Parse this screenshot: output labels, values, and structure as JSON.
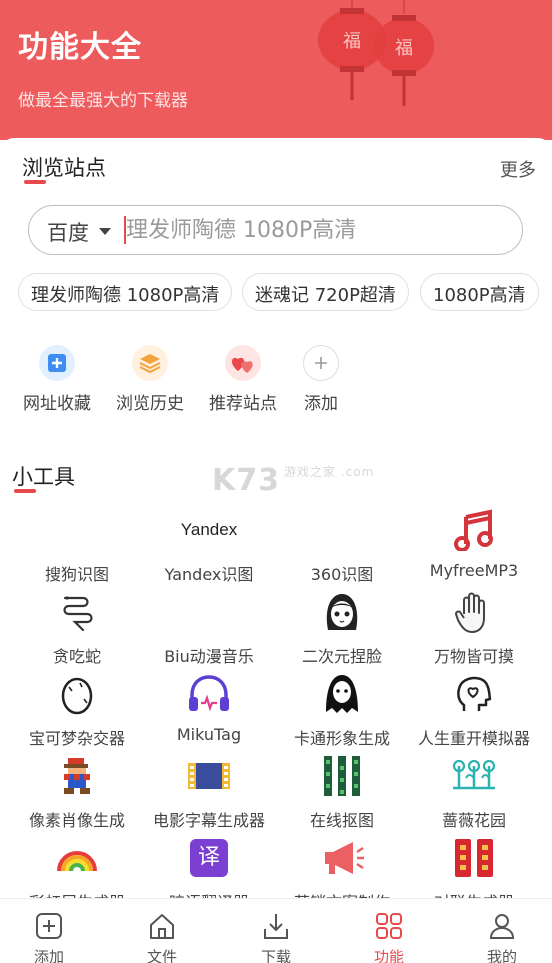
{
  "header": {
    "title": "功能大全",
    "subtitle": "做最全最强大的下载器",
    "lantern_char": "福",
    "bg_color": "#ee5b5d"
  },
  "browse": {
    "title": "浏览站点",
    "more_label": "更多",
    "search": {
      "engine": "百度",
      "placeholder": "理发师陶德 1080P高清"
    },
    "chips": [
      "理发师陶德 1080P高清",
      "迷魂记 720P超清",
      "1080P高清"
    ],
    "quick_actions": [
      {
        "label": "网址收藏",
        "icon": "bookmark-plus-icon"
      },
      {
        "label": "浏览历史",
        "icon": "history-layers-icon"
      },
      {
        "label": "推荐站点",
        "icon": "recommend-hearts-icon"
      },
      {
        "label": "添加",
        "icon": "plus-icon"
      }
    ]
  },
  "tools": {
    "title": "小工具",
    "watermark": "K73",
    "watermark_sub": "游戏之家 .com",
    "yandex_logo_text": "Yandex",
    "translate_glyph": "译",
    "items": [
      {
        "label": "搜狗识图",
        "icon": "sogou-image-icon"
      },
      {
        "label": "Yandex识图",
        "icon": "yandex-logo"
      },
      {
        "label": "360识图",
        "icon": "360-image-icon"
      },
      {
        "label": "MyfreeMP3",
        "icon": "music-note-icon"
      },
      {
        "label": "贪吃蛇",
        "icon": "snake-icon"
      },
      {
        "label": "Biu动漫音乐",
        "icon": "anime-music-icon"
      },
      {
        "label": "二次元捏脸",
        "icon": "anime-face-icon"
      },
      {
        "label": "万物皆可摸",
        "icon": "hand-icon"
      },
      {
        "label": "宝可梦杂交器",
        "icon": "egg-icon"
      },
      {
        "label": "MikuTag",
        "icon": "headphones-icon"
      },
      {
        "label": "卡通形象生成",
        "icon": "ghost-icon"
      },
      {
        "label": "人生重开模拟器",
        "icon": "head-heart-icon"
      },
      {
        "label": "像素肖像生成",
        "icon": "pixel-mario-icon"
      },
      {
        "label": "电影字幕生成器",
        "icon": "film-strip-icon"
      },
      {
        "label": "在线抠图",
        "icon": "cutout-grid-icon"
      },
      {
        "label": "蔷薇花园",
        "icon": "garden-icon"
      },
      {
        "label": "彩虹屁生成器",
        "icon": "rainbow-icon"
      },
      {
        "label": "暗语翻译器",
        "icon": "translate-icon"
      },
      {
        "label": "营销文案制作",
        "icon": "megaphone-icon"
      },
      {
        "label": "对联生成器",
        "icon": "couplet-icon"
      }
    ]
  },
  "tabbar": {
    "items": [
      {
        "label": "添加",
        "icon": "add-square-icon"
      },
      {
        "label": "文件",
        "icon": "home-file-icon"
      },
      {
        "label": "下载",
        "icon": "download-tray-icon"
      },
      {
        "label": "功能",
        "icon": "grid-four-icon",
        "active": true
      },
      {
        "label": "我的",
        "icon": "user-icon"
      }
    ],
    "active_color": "#e84a4c"
  }
}
